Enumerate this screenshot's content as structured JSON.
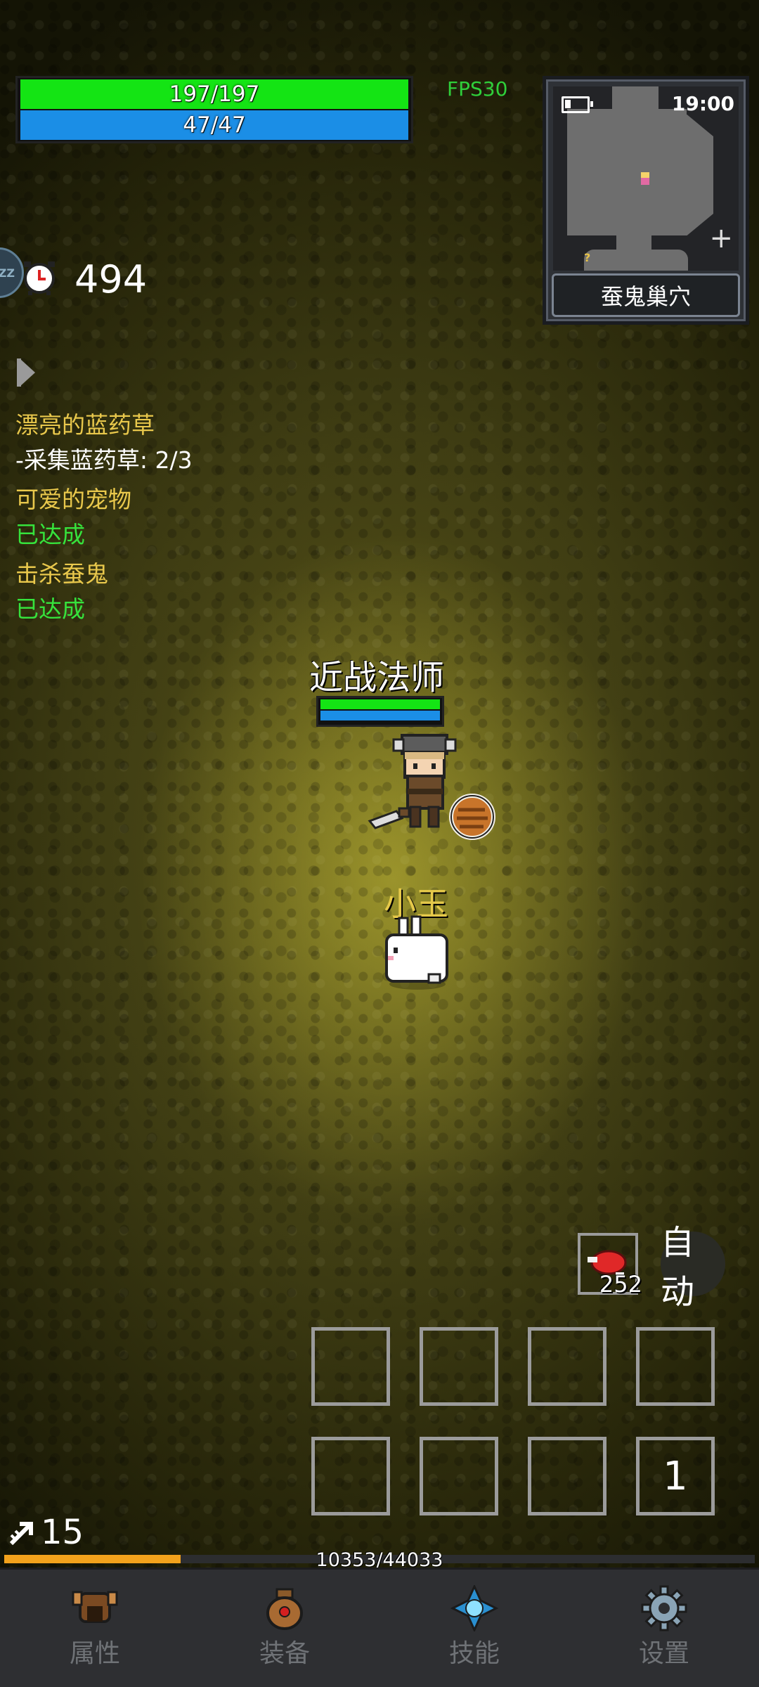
{
  "hud": {
    "hp": {
      "label": "197/197",
      "fraction": 1.0,
      "color": "#14e414"
    },
    "mp": {
      "label": "47/47",
      "fraction": 1.0,
      "color": "#1b8ee6"
    },
    "fps": "FPS30"
  },
  "minimap": {
    "time": "19:00",
    "area_name": "蚕鬼巢穴",
    "marker": "?",
    "plus": "+"
  },
  "timer": {
    "sleep_badge": "ZZ",
    "value": "494"
  },
  "quests": [
    {
      "title": "漂亮的蓝药草",
      "detail": "-采集蓝药草: 2/3"
    },
    {
      "title": "可爱的宠物",
      "status": "已达成"
    },
    {
      "title": "击杀蚕鬼",
      "status": "已达成"
    }
  ],
  "character": {
    "name": "近战法师",
    "hp_fraction": 1.0,
    "mp_fraction": 1.0
  },
  "pet": {
    "name": "小玉"
  },
  "item": {
    "count": "252",
    "icon": "meat-icon"
  },
  "auto_button": "自动",
  "skill_slots": [
    "",
    "",
    "",
    "",
    "",
    "",
    "",
    "1"
  ],
  "level": {
    "value": "15",
    "icon": "level-arrow-icon"
  },
  "xp": {
    "text": "10353/44033",
    "current": 10353,
    "max": 44033,
    "color": "#f3a21c"
  },
  "nav": [
    {
      "label": "属性",
      "icon": "helmet-icon"
    },
    {
      "label": "装备",
      "icon": "bag-icon"
    },
    {
      "label": "技能",
      "icon": "skill-gem-icon"
    },
    {
      "label": "设置",
      "icon": "gear-icon"
    }
  ]
}
